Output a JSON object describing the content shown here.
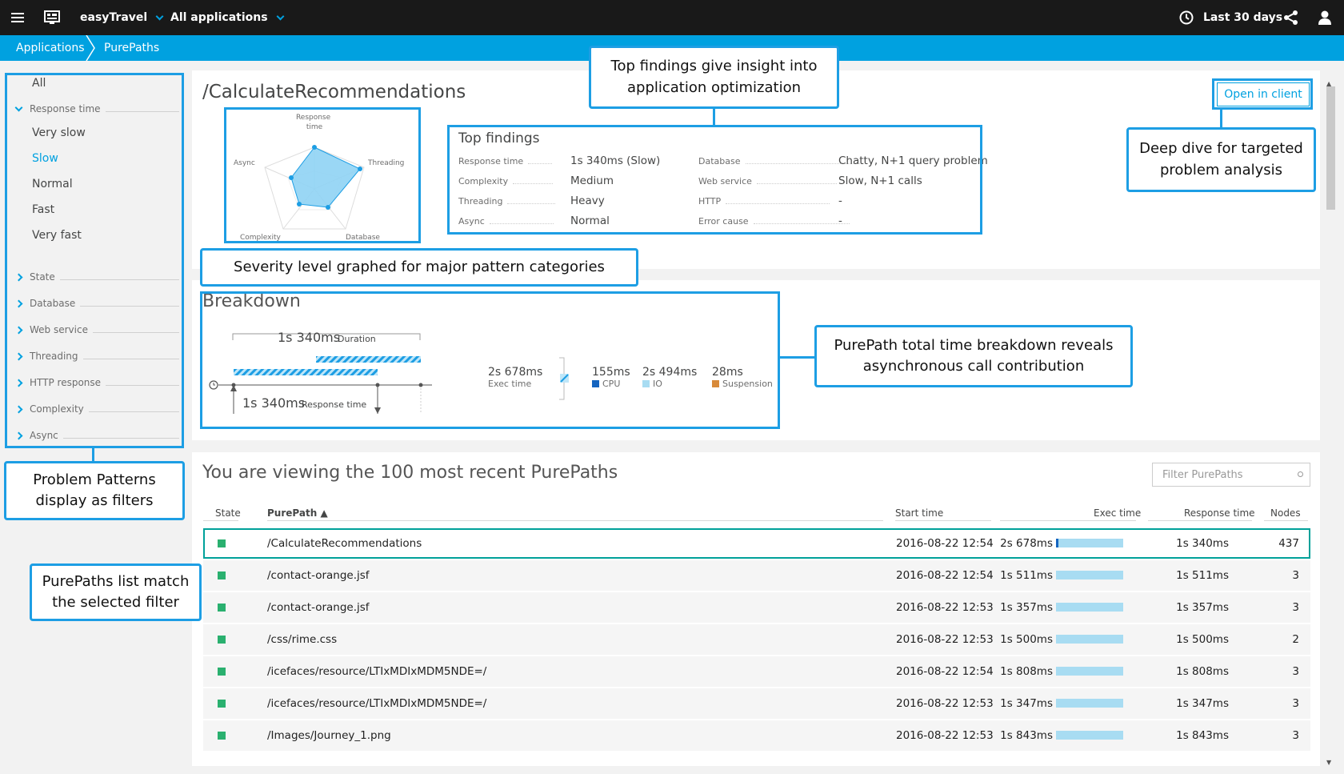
{
  "topbar": {
    "app_name": "easyTravel",
    "app_scope": "All applications",
    "timeframe": "Last 30 days"
  },
  "breadcrumb": [
    "Applications",
    "PurePaths"
  ],
  "sidebar": {
    "all": "All",
    "response_time_group": "Response time",
    "response_items": [
      "Very slow",
      "Slow",
      "Normal",
      "Fast",
      "Very fast"
    ],
    "selected": "Slow",
    "groups": [
      "State",
      "Database",
      "Web service",
      "Threading",
      "HTTP response",
      "Complexity",
      "Async"
    ]
  },
  "page": {
    "title": "/CalculateRecommendations",
    "open_client_button": "Open in client"
  },
  "radar": {
    "labels": {
      "response_time": "Response time",
      "threading": "Threading",
      "database": "Database",
      "complexity": "Complexity",
      "async": "Async"
    }
  },
  "findings": {
    "title": "Top findings",
    "left": [
      {
        "label": "Response time",
        "value": "1s 340ms (Slow)"
      },
      {
        "label": "Complexity",
        "value": "Medium"
      },
      {
        "label": "Threading",
        "value": "Heavy"
      },
      {
        "label": "Async",
        "value": "Normal"
      }
    ],
    "right": [
      {
        "label": "Database",
        "value": "Chatty, N+1 query problem"
      },
      {
        "label": "Web service",
        "value": "Slow, N+1 calls"
      },
      {
        "label": "HTTP",
        "value": "-"
      },
      {
        "label": "Error cause",
        "value": "-"
      }
    ]
  },
  "breakdown": {
    "title": "Breakdown",
    "duration_value": "1s 340ms",
    "duration_label": "Duration",
    "response_value": "1s 340ms",
    "response_label": "Response time",
    "exec_value": "2s 678ms",
    "exec_label": "Exec time",
    "cpu_value": "155ms",
    "cpu_label": "CPU",
    "io_value": "2s 494ms",
    "io_label": "IO",
    "susp_value": "28ms",
    "susp_label": "Suspension",
    "colors": {
      "cpu": "#1565c0",
      "io": "#a8dcf2",
      "suspension": "#d88a3a"
    }
  },
  "list": {
    "title": "You are viewing the 100 most recent PurePaths",
    "filter_placeholder": "Filter PurePaths",
    "headers": {
      "state": "State",
      "purepath": "PurePath",
      "start_time": "Start time",
      "exec_time": "Exec time",
      "response_time": "Response time",
      "nodes": "Nodes"
    },
    "rows": [
      {
        "path": "/CalculateRecommendations",
        "start": "2016-08-22 12:54",
        "exec": "2s 678ms",
        "resp": "1s 340ms",
        "nodes": "437"
      },
      {
        "path": "/contact-orange.jsf",
        "start": "2016-08-22 12:54",
        "exec": "1s 511ms",
        "resp": "1s 511ms",
        "nodes": "3"
      },
      {
        "path": "/contact-orange.jsf",
        "start": "2016-08-22 12:53",
        "exec": "1s 357ms",
        "resp": "1s 357ms",
        "nodes": "3"
      },
      {
        "path": "/css/rime.css",
        "start": "2016-08-22 12:53",
        "exec": "1s 500ms",
        "resp": "1s 500ms",
        "nodes": "2"
      },
      {
        "path": "/icefaces/resource/LTIxMDIxMDM5NDE=/",
        "start": "2016-08-22 12:54",
        "exec": "1s 808ms",
        "resp": "1s 808ms",
        "nodes": "3"
      },
      {
        "path": "/icefaces/resource/LTIxMDIxMDM5NDE=/",
        "start": "2016-08-22 12:53",
        "exec": "1s 347ms",
        "resp": "1s 347ms",
        "nodes": "3"
      },
      {
        "path": "/Images/Journey_1.png",
        "start": "2016-08-22 12:53",
        "exec": "1s 843ms",
        "resp": "1s 843ms",
        "nodes": "3"
      }
    ]
  },
  "callouts": {
    "top_findings": "Top findings give insight into application optimization",
    "deep_dive": "Deep dive for targeted problem analysis",
    "severity": "Severity level graphed for major pattern categories",
    "breakdown": "PurePath total time breakdown reveals asynchronous call contribution",
    "patterns": "Problem Patterns display as filters",
    "list_match": "PurePaths list match the selected filter"
  },
  "theme": {
    "accent": "#00a1e0",
    "callout": "#1d9ee4",
    "state_ok": "#2ab06f"
  }
}
